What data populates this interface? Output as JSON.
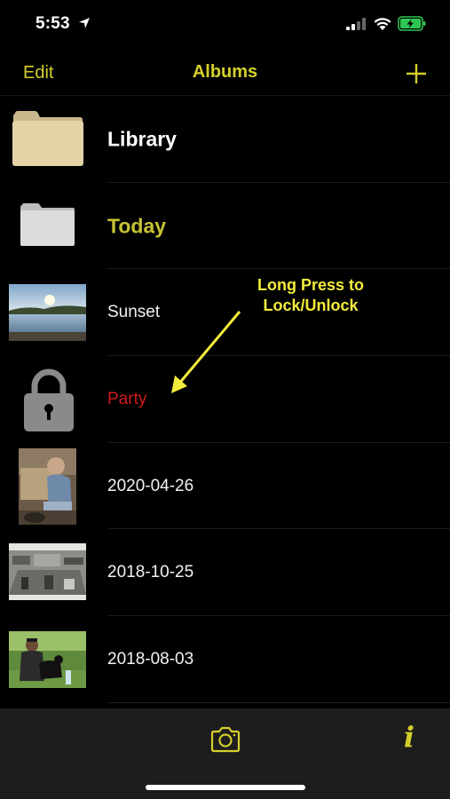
{
  "status_bar": {
    "time": "5:53",
    "icons": [
      "location-arrow-icon",
      "signal-bars-icon",
      "wifi-icon",
      "battery-charging-icon"
    ]
  },
  "nav": {
    "edit_label": "Edit",
    "title": "Albums",
    "add_icon": "plus-icon"
  },
  "albums": [
    {
      "label": "Library",
      "thumb": "folder-icon",
      "style": "bold",
      "color": "#ffffff"
    },
    {
      "label": "Today",
      "thumb": "folder-icon",
      "style": "bold",
      "color": "#c8c336"
    },
    {
      "label": "Sunset",
      "thumb": "photo-thumbnail",
      "style": "regular",
      "color": "#f2f2f2"
    },
    {
      "label": "Party",
      "thumb": "lock-icon",
      "style": "regular",
      "color": "#d11a1a"
    },
    {
      "label": "2020-04-26",
      "thumb": "photo-thumbnail",
      "style": "regular",
      "color": "#f2f2f2"
    },
    {
      "label": "2018-10-25",
      "thumb": "photo-thumbnail",
      "style": "regular",
      "color": "#f2f2f2"
    },
    {
      "label": "2018-08-03",
      "thumb": "photo-thumbnail",
      "style": "regular",
      "color": "#f2f2f2"
    }
  ],
  "annotation": {
    "line1": "Long Press to",
    "line2": "Lock/Unlock"
  },
  "toolbar": {
    "camera_icon": "camera-icon",
    "info_icon": "info-icon",
    "info_glyph": "i"
  },
  "colors": {
    "accent": "#d4cf2b",
    "annotation": "#f4ec3b",
    "locked_album": "#d11a1a",
    "background": "#000000",
    "toolbar": "#1d1d1d"
  }
}
